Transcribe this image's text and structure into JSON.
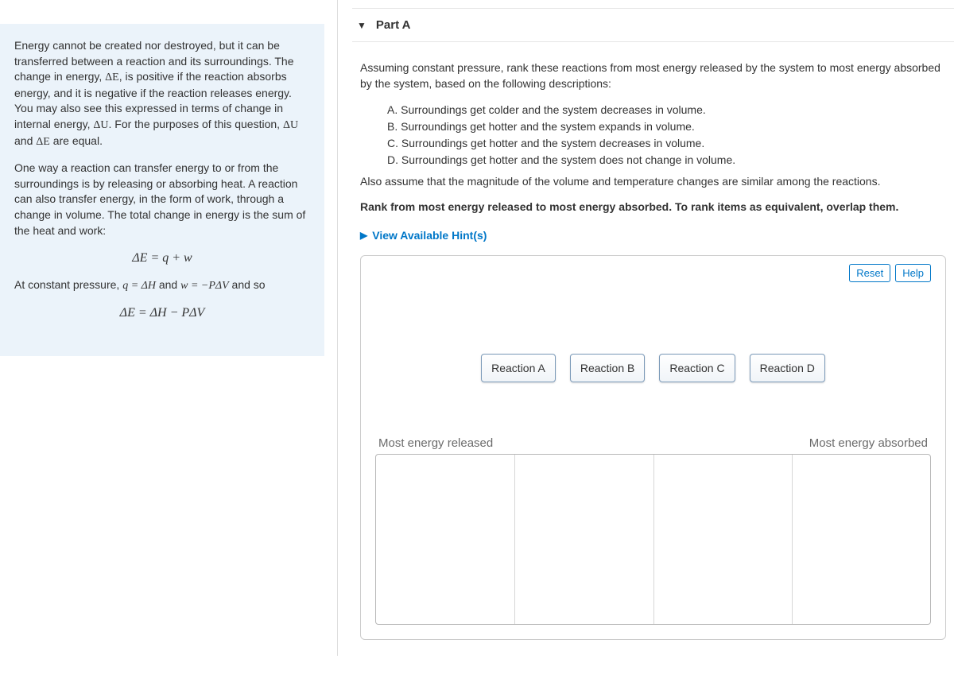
{
  "intro": {
    "p1_a": "Energy cannot be created nor destroyed, but it can be transferred between a reaction and its surroundings. The change in energy, ",
    "p1_deltaE": "ΔE",
    "p1_b": ", is positive if the reaction absorbs energy, and it is negative if the reaction releases energy. You may also see this expressed in terms of change in internal energy, ",
    "p1_deltaU": "ΔU",
    "p1_c": ". For the purposes of this question, ",
    "p1_deltaU2": "ΔU",
    "p1_and": " and ",
    "p1_deltaE2": "ΔE",
    "p1_d": " are equal.",
    "p2": "One way a reaction can transfer energy to or from the surroundings is by releasing or absorbing heat. A reaction can also transfer energy, in the form of work, through a change in volume. The total change in energy is the sum of the heat and work:",
    "eq1": "ΔE = q + w",
    "p3_a": "At constant pressure, ",
    "p3_q": "q = ΔH",
    "p3_b": " and ",
    "p3_w": "w = −PΔV",
    "p3_c": " and so",
    "eq2": "ΔE = ΔH − PΔV"
  },
  "part": {
    "title": "Part A"
  },
  "question": {
    "intro": "Assuming constant pressure, rank these reactions from most energy released by the system to most energy absorbed by the system, based on the following descriptions:",
    "options": {
      "A": "A. Surroundings get colder and the system decreases in volume.",
      "B": "B. Surroundings get hotter and the system expands in volume.",
      "C": "C.  Surroundings get hotter and the system decreases in volume.",
      "D": "D. Surroundings get hotter and the system does not change in volume."
    },
    "assume": "Also assume that the magnitude of the volume and temperature changes are similar among the reactions.",
    "instruction": "Rank from most energy released to most energy absorbed. To rank items as equivalent, overlap them.",
    "hints": "View Available Hint(s)"
  },
  "ranking": {
    "reset": "Reset",
    "help": "Help",
    "items": [
      "Reaction A",
      "Reaction B",
      "Reaction C",
      "Reaction D"
    ],
    "left_label": "Most energy released",
    "right_label": "Most energy absorbed"
  }
}
